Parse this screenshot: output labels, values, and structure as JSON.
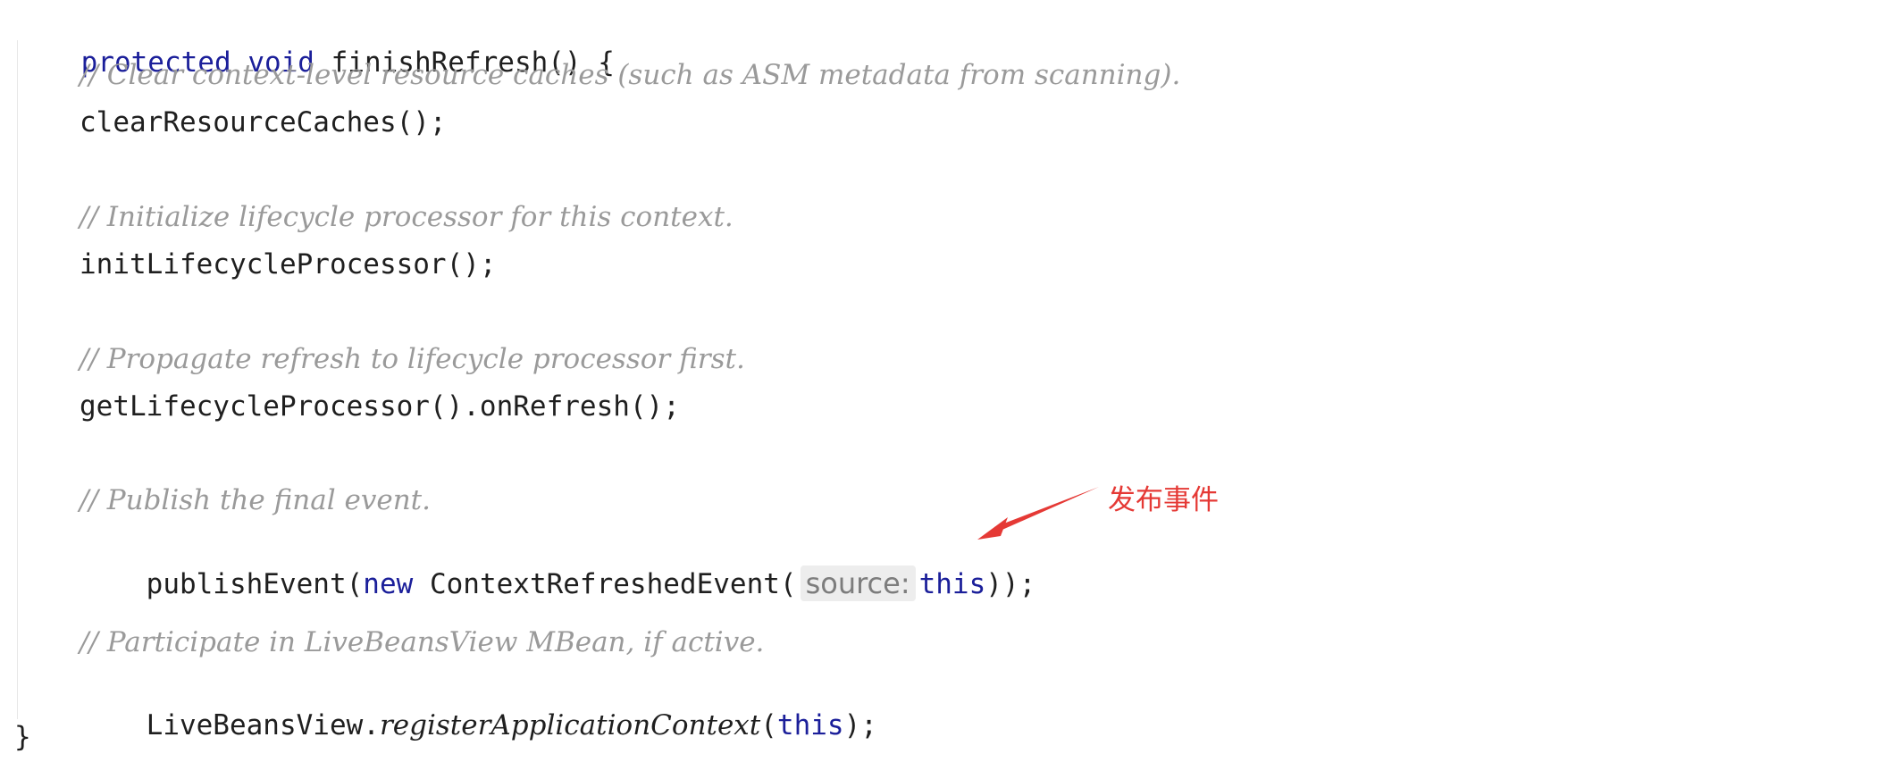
{
  "code": {
    "signature": {
      "protected_kw": "protected",
      "void_kw": "void",
      "name": "finishRefresh() {"
    },
    "lines": {
      "comment_1": "// Clear context-level resource caches (such as ASM metadata from scanning).",
      "call_1": "clearResourceCaches();",
      "comment_2": "// Initialize lifecycle processor for this context.",
      "call_2": "initLifecycleProcessor();",
      "comment_3": "// Propagate refresh to lifecycle processor first.",
      "call_3": "getLifecycleProcessor().onRefresh();",
      "comment_4": "// Publish the final event.",
      "call_4": {
        "prefix": "publishEvent(",
        "new_kw": "new",
        "ctor": " ContextRefreshedEvent(",
        "hint": "source:",
        "this_kw": "this",
        "suffix": "));"
      },
      "comment_5": "// Participate in LiveBeansView MBean, if active.",
      "call_5": {
        "class_name": "LiveBeansView.",
        "method": "registerApplicationContext",
        "open": "(",
        "this_kw": "this",
        "close": ");"
      }
    },
    "closing_brace": "}"
  },
  "annotation": {
    "label": "发布事件",
    "color": "#e53935"
  },
  "colors": {
    "keyword": "#1b1f9a",
    "comment": "#9a9a9a",
    "text": "#1f1f1f"
  }
}
